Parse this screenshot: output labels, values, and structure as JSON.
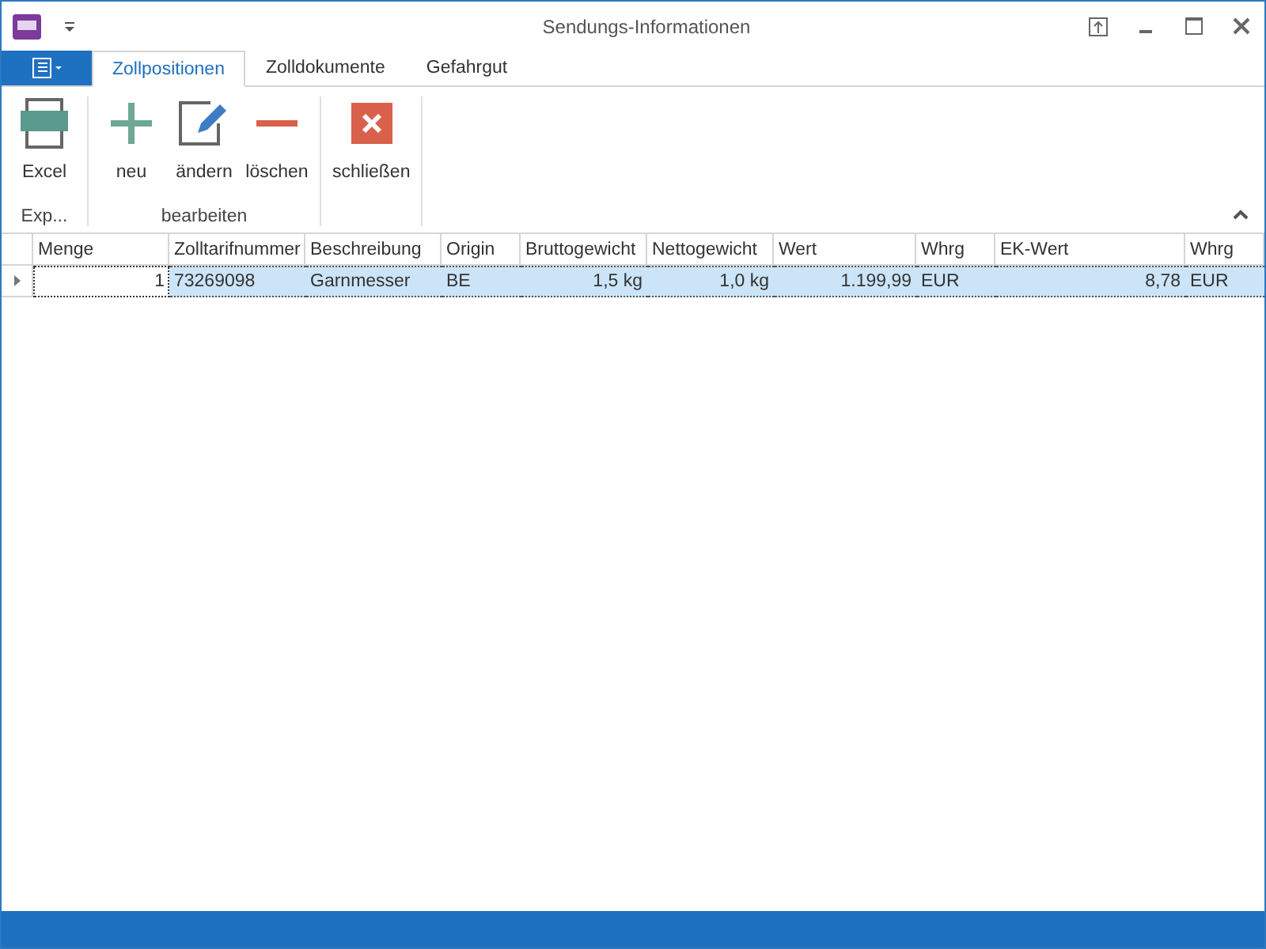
{
  "window": {
    "title": "Sendungs-Informationen"
  },
  "tabs": [
    {
      "label": "Zollpositionen",
      "selected": true
    },
    {
      "label": "Zolldokumente",
      "selected": false
    },
    {
      "label": "Gefahrgut",
      "selected": false
    }
  ],
  "ribbon_groups": [
    {
      "label": "Exp...",
      "buttons": [
        {
          "label": "Excel",
          "kind": "excel"
        }
      ]
    },
    {
      "label": "bearbeiten",
      "buttons": [
        {
          "label": "neu",
          "kind": "add"
        },
        {
          "label": "ändern",
          "kind": "edit"
        },
        {
          "label": "löschen",
          "kind": "delete"
        }
      ]
    },
    {
      "buttons": [
        {
          "label": "schließen",
          "kind": "close"
        }
      ]
    }
  ],
  "table": {
    "columns": [
      {
        "label": "Menge",
        "kind": "number"
      },
      {
        "label": "Zolltarifnummer",
        "kind": "text"
      },
      {
        "label": "Beschreibung",
        "kind": "text"
      },
      {
        "label": "Origin",
        "kind": "text"
      },
      {
        "label": "Bruttogewicht",
        "kind": "number"
      },
      {
        "label": "Nettogewicht",
        "kind": "number"
      },
      {
        "label": "Wert",
        "kind": "number"
      },
      {
        "label": "Whrg",
        "kind": "text"
      },
      {
        "label": "EK-Wert",
        "kind": "number"
      },
      {
        "label": "Whrg",
        "kind": "text"
      }
    ],
    "rows": [
      {
        "selected": true,
        "cells": [
          {
            "text": "1",
            "focused": true
          },
          {
            "text": "73269098",
            "focused": false
          },
          {
            "text": "Garnmesser",
            "focused": false
          },
          {
            "text": "BE",
            "focused": false
          },
          {
            "text": "1,5 kg",
            "focused": false
          },
          {
            "text": "1,0 kg",
            "focused": false
          },
          {
            "text": "1.199,99",
            "focused": false
          },
          {
            "text": "EUR",
            "focused": false
          },
          {
            "text": "8,78",
            "focused": false
          },
          {
            "text": "EUR",
            "focused": false
          }
        ]
      }
    ]
  }
}
